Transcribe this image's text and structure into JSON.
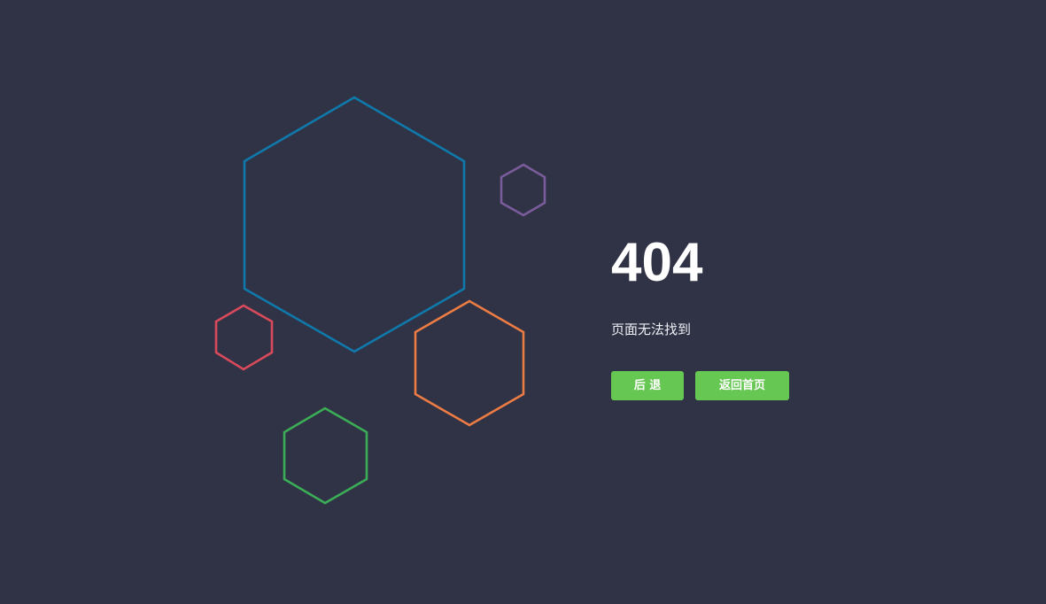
{
  "error": {
    "code": "404",
    "message": "页面无法找到"
  },
  "actions": {
    "back_label": "后 退",
    "home_label": "返回首页"
  },
  "colors": {
    "background": "#303345",
    "button": "#67c753",
    "hex_blue": "#0f79ab",
    "hex_purple": "#7a5b9b",
    "hex_red": "#d84a5b",
    "hex_orange": "#ec7c43",
    "hex_green": "#3aad56"
  }
}
